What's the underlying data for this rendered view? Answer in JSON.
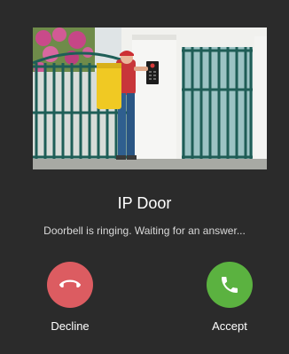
{
  "call": {
    "caller_name": "IP Door",
    "status_text": "Doorbell is ringing. Waiting for an answer..."
  },
  "actions": {
    "decline_label": "Decline",
    "accept_label": "Accept"
  },
  "colors": {
    "background": "#2b2b2b",
    "decline": "#dc5c61",
    "accept": "#5bb240"
  },
  "icons": {
    "decline": "phone-hangup-icon",
    "accept": "phone-icon"
  }
}
